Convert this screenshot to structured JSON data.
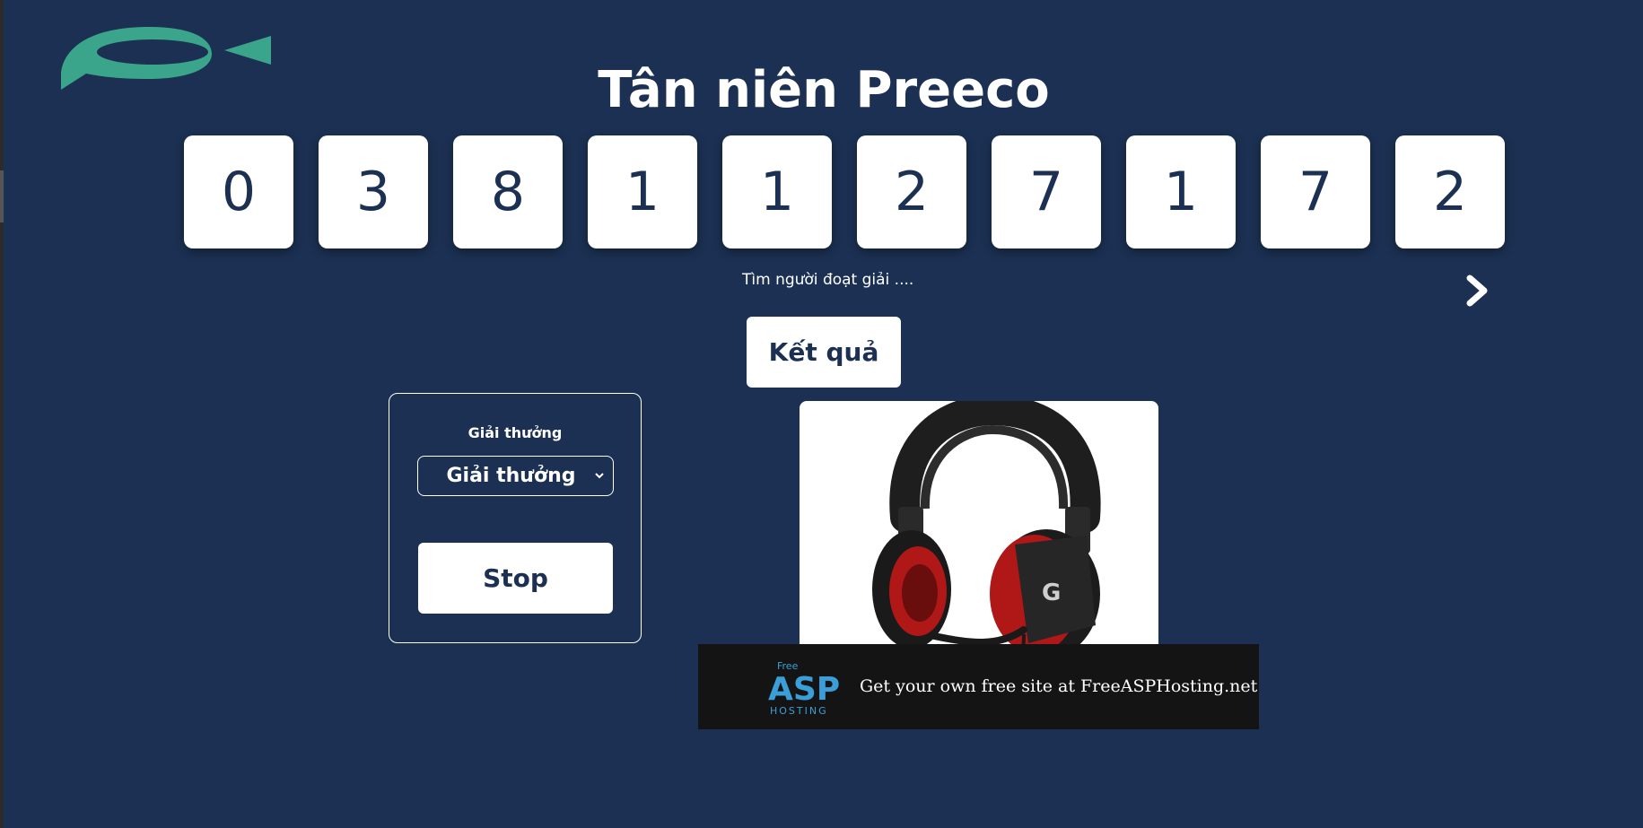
{
  "page": {
    "title": "Tân niên Preeco",
    "background": "#1b3052"
  },
  "logo": {
    "icon": "speech-bubble-fish-logo",
    "color": "#3aa58a"
  },
  "number_display": {
    "digits": [
      "0",
      "3",
      "8",
      "1",
      "1",
      "2",
      "7",
      "1",
      "7",
      "2"
    ]
  },
  "status": {
    "text": "Tìm người đoạt giải ...."
  },
  "navigation": {
    "next_icon": "chevron-right-icon"
  },
  "result_button": {
    "label": "Kết quả"
  },
  "prize_panel": {
    "label": "Giải thưởng",
    "select_value": "Giải thưởng",
    "stop_label": "Stop"
  },
  "prize_image": {
    "description_icon": "headset-icon"
  },
  "ad_banner": {
    "logo_top": "Free",
    "logo_main": "ASP",
    "logo_bottom": "HOSTING",
    "text": "Get your own free site at FreeASPHosting.net"
  }
}
